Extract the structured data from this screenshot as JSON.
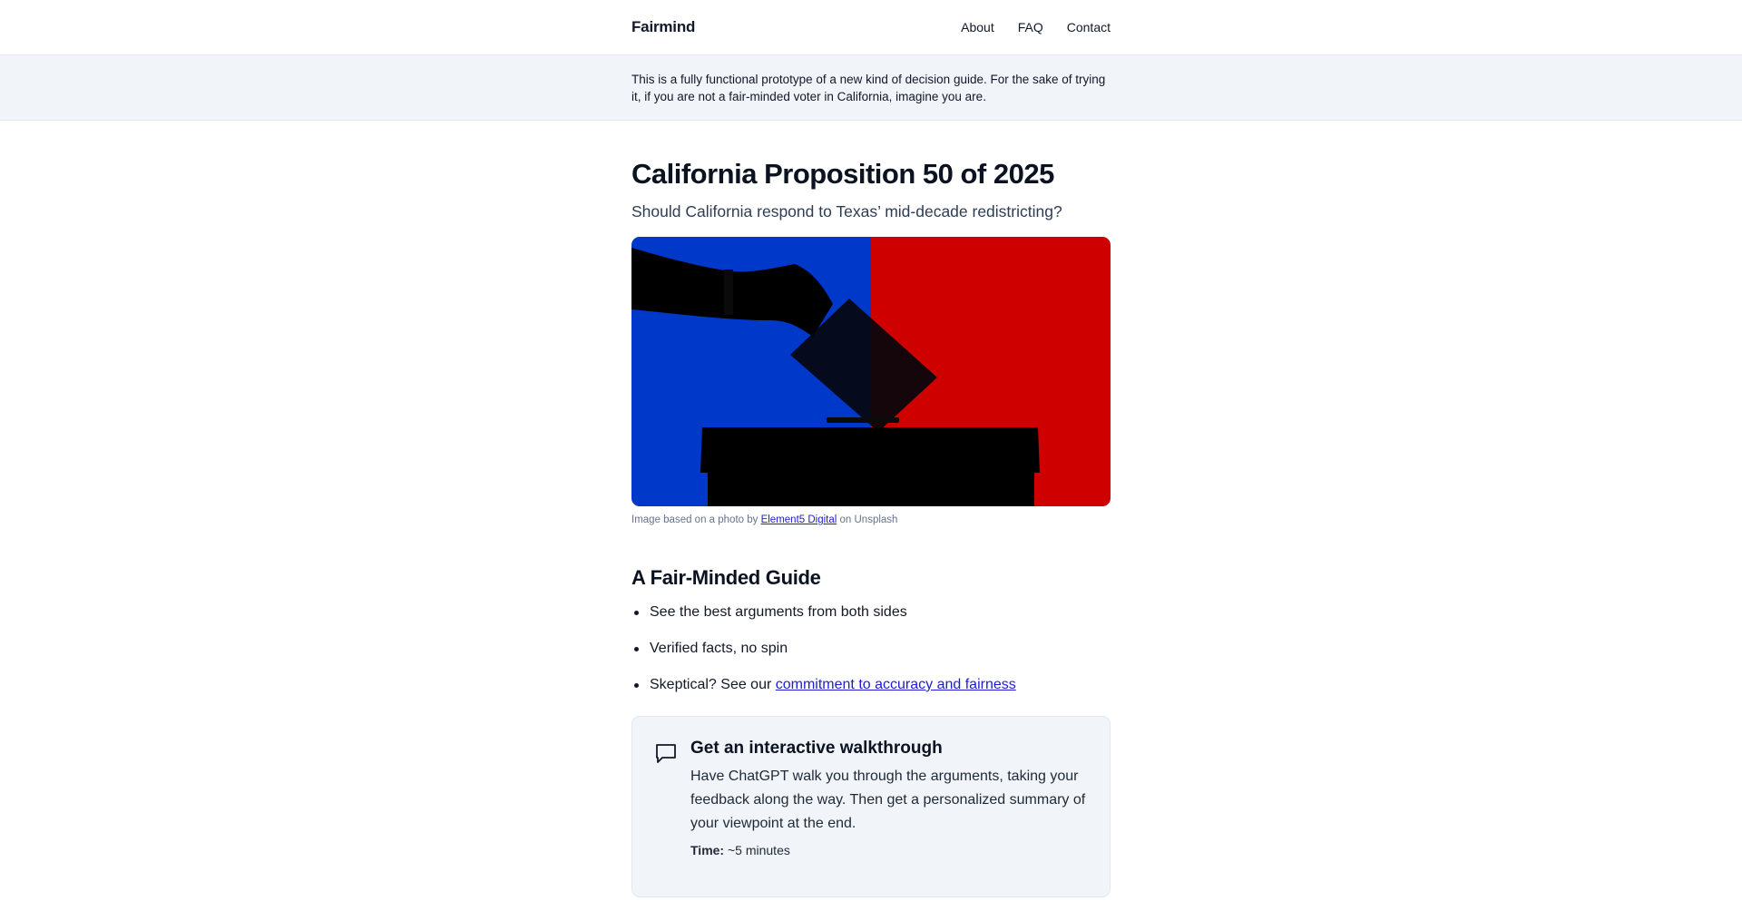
{
  "header": {
    "logo": "Fairmind",
    "nav": [
      "About",
      "FAQ",
      "Contact"
    ]
  },
  "notice": {
    "text": "This is a fully functional prototype of a new kind of decision guide. For the sake of trying it, if you are not a fair-minded voter in California, imagine you are."
  },
  "main": {
    "title": "California Proposition 50 of 2025",
    "subtitle": "Should California respond to Texas’ mid-decade redistricting?",
    "image": {
      "alt": "Silhouette of a hand dropping a ballot into a ballot box",
      "caption_prefix": "Image based on a photo by ",
      "caption_link": "Element5 Digital",
      "caption_suffix": " on Unsplash",
      "colors": {
        "left": "#0038c9",
        "right": "#cf0000"
      }
    },
    "guide": {
      "title": "A Fair-Minded Guide",
      "items": [
        "See the best arguments from both sides",
        "Verified facts, no spin"
      ],
      "skeptical_prefix": "Skeptical? See our ",
      "skeptical_link": "commitment to accuracy and fairness"
    },
    "walkthrough": {
      "icon": "chat-icon",
      "title": "Get an interactive walkthrough",
      "text": "Have ChatGPT walk you through the arguments, taking your feedback along the way. Then get a personalized summary of your viewpoint at the end.",
      "time_label": "Time:",
      "time_value": " ~5 minutes"
    }
  }
}
